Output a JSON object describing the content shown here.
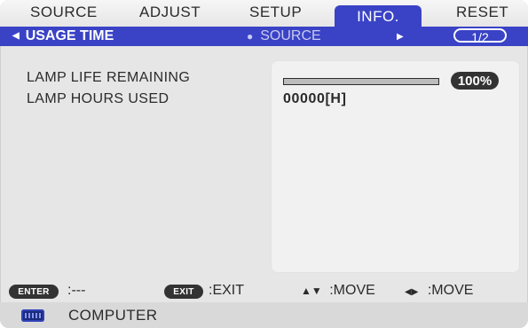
{
  "tabs": [
    {
      "label": "SOURCE"
    },
    {
      "label": "ADJUST"
    },
    {
      "label": "SETUP"
    },
    {
      "label": "INFO.",
      "active": true
    },
    {
      "label": "RESET"
    }
  ],
  "subheader": {
    "current": "USAGE TIME",
    "next": "SOURCE",
    "page": "1/2"
  },
  "items": [
    {
      "label": "LAMP LIFE REMAINING",
      "value": "100%",
      "progress_percent": 100
    },
    {
      "label": "LAMP HOURS USED",
      "value": "00000[H]"
    }
  ],
  "footer": {
    "enter_key": "ENTER",
    "enter_hint": ":---",
    "exit_key": "EXIT",
    "exit_hint": ":EXIT",
    "move_vertical": ":MOVE",
    "move_horizontal": ":MOVE"
  },
  "status": {
    "source_label": "COMPUTER"
  },
  "colors": {
    "accent": "#3a43c6",
    "panel": "#e6e6e6",
    "pill": "#333333"
  },
  "icons": {
    "source": "computer-icon"
  }
}
